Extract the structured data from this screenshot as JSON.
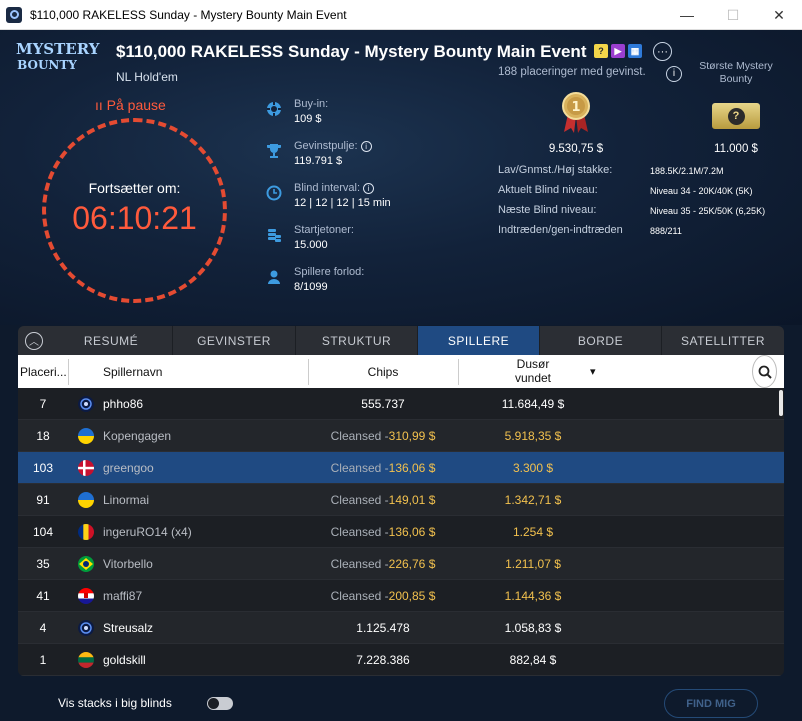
{
  "window": {
    "title": "$110,000 RAKELESS Sunday - Mystery Bounty Main Event",
    "minimize": "—",
    "maximize": "☐",
    "close": "✕"
  },
  "logo": {
    "line1": "MYSTERY",
    "line2": "BOUNTY"
  },
  "event": {
    "title": "$110,000 RAKELESS Sunday - Mystery Bounty Main Event",
    "game": "NL Hold'em",
    "more": "···"
  },
  "status": {
    "paused": "ıı På pause",
    "resume_label": "Fortsætter om:",
    "countdown": "06:10:21"
  },
  "info": [
    {
      "icon": "poker-chip-icon",
      "label": "Buy-in:",
      "value": "109 $"
    },
    {
      "icon": "trophy-icon",
      "label": "Gevinstpulje:",
      "value": "119.791 $"
    },
    {
      "icon": "clock-icon",
      "label": "Blind interval:",
      "value": "12 | 12 | 12 | 15 min"
    },
    {
      "icon": "chip-stack-icon",
      "label": "Startjetoner:",
      "value": "15.000"
    },
    {
      "icon": "player-icon",
      "label": "Spillere forlod:",
      "value": "8/1099"
    }
  ],
  "prizes": {
    "places_text": "188 placeringer med gevinst.",
    "bounty_label": "Største Mystery Bounty",
    "first_prize": "9.530,75 $",
    "bounty_value": "11.000 $",
    "medal_number": "1",
    "ticket_symbol": "?"
  },
  "stats": [
    {
      "label": "Lav/Gnmst./Høj stakke:",
      "value": "188.5K/2.1M/7.2M"
    },
    {
      "label": "Aktuelt Blind niveau:",
      "value": "Niveau 34 - 20K/40K (5K)"
    },
    {
      "label": "Næste Blind niveau:",
      "value": "Niveau 35 - 25K/50K (6,25K)"
    },
    {
      "label": "Indtræden/gen-indtræden",
      "value": "888/211"
    }
  ],
  "tabs": [
    "RESUMÉ",
    "GEVINSTER",
    "STRUKTUR",
    "SPILLERE",
    "BORDE",
    "SATELLITTER"
  ],
  "active_tab": "SPILLERE",
  "columns": {
    "place": "Placeri...",
    "name": "Spillernavn",
    "chips": "Chips",
    "won": "Dusør vundet",
    "sort": "▾"
  },
  "cleansed_prefix": "Cleansed - ",
  "players": [
    {
      "place": "7",
      "flag": "pokerstars",
      "name": "phho86",
      "chips": "555.737",
      "cleansed": "",
      "won": "11.684,49 $"
    },
    {
      "place": "18",
      "flag": "ukraine",
      "name": "Kopengagen",
      "chips": "Cleansed - ",
      "cleansed": "310,99 $",
      "won": "5.918,35 $"
    },
    {
      "place": "103",
      "flag": "denmark",
      "name": "greengoo",
      "chips": "Cleansed - ",
      "cleansed": "136,06 $",
      "won": "3.300 $"
    },
    {
      "place": "91",
      "flag": "ukraine",
      "name": "Linormai",
      "chips": "Cleansed - ",
      "cleansed": "149,01 $",
      "won": "1.342,71 $"
    },
    {
      "place": "104",
      "flag": "romania",
      "name": "ingeruRO14 (x4)",
      "chips": "Cleansed - ",
      "cleansed": "136,06 $",
      "won": "1.254 $"
    },
    {
      "place": "35",
      "flag": "brazil",
      "name": "Vitorbello",
      "chips": "Cleansed - ",
      "cleansed": "226,76 $",
      "won": "1.211,07 $"
    },
    {
      "place": "41",
      "flag": "croatia",
      "name": "maffi87",
      "chips": "Cleansed - ",
      "cleansed": "200,85 $",
      "won": "1.144,36 $"
    },
    {
      "place": "4",
      "flag": "pokerstars",
      "name": "Streusalz",
      "chips": "1.125.478",
      "cleansed": "",
      "won": "1.058,83 $"
    },
    {
      "place": "1",
      "flag": "lithuania",
      "name": "goldskill",
      "chips": "7.228.386",
      "cleansed": "",
      "won": "882,84 $"
    }
  ],
  "footer": {
    "stacks_label": "Vis stacks i big blinds",
    "find_me": "FIND MIG"
  }
}
